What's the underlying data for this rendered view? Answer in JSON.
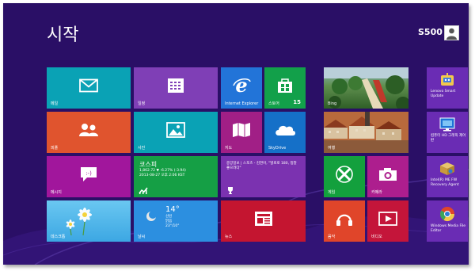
{
  "screen": {
    "title": "시작",
    "user": "S500",
    "colors": {
      "background": "#2a0f66"
    }
  },
  "tiles": {
    "mail": {
      "label": "메일",
      "color": "#0aa2b5",
      "icon": "mail-icon"
    },
    "calendar": {
      "label": "일정",
      "color": "#7f3fb6",
      "icon": "calendar-icon"
    },
    "ie": {
      "label": "Internet Explorer",
      "color": "#2274d8",
      "icon": "internet-explorer-icon"
    },
    "store": {
      "label": "스토어",
      "badge": "15",
      "color": "#12a04a",
      "icon": "store-icon"
    },
    "people": {
      "label": "피플",
      "color": "#e0542e",
      "icon": "people-icon"
    },
    "photos": {
      "label": "사진",
      "color": "#0aa2b5",
      "icon": "photos-icon"
    },
    "maps": {
      "label": "지도",
      "color": "#a11f86",
      "icon": "maps-icon"
    },
    "skydrive": {
      "label": "SkyDrive",
      "color": "#1570c8",
      "icon": "cloud-icon"
    },
    "messaging": {
      "label": "메시지",
      "color": "#a1169c",
      "icon": "messaging-icon"
    },
    "finance": {
      "title": "코스피",
      "line1": "1,862.72  ▼ -6.27% (-3.94)",
      "line2": "2013-08-27 오후 2:06 KST",
      "color": "#159f45",
      "icon": "chart-icon"
    },
    "sports": {
      "text": "중앙일보 | 스포츠 - 김연아, \"발로로 180, 정말 좋으려다\"",
      "color": "#7b32b0",
      "icon": "trophy-icon"
    },
    "desktop": {
      "label": "데스크톱",
      "color": "#4db0e6"
    },
    "weather": {
      "temp": "14°",
      "city": "선린",
      "condition": "맑음",
      "range": "23°/10°",
      "label": "날씨",
      "color": "#2c8fe0",
      "icon": "weather-icon"
    },
    "news": {
      "label": "뉴스",
      "color": "#c41530",
      "icon": "news-icon"
    },
    "bing": {
      "label": "Bing"
    },
    "travel": {
      "label": "여행"
    },
    "games": {
      "label": "게임",
      "color": "#13a03d",
      "icon": "xbox-games-icon"
    },
    "camera": {
      "label": "카메라",
      "color": "#ad1e8e",
      "icon": "camera-icon"
    },
    "music": {
      "label": "음악",
      "color": "#e0452a",
      "icon": "headphones-icon"
    },
    "video": {
      "label": "비디오",
      "color": "#c4153a",
      "icon": "video-icon"
    },
    "lenovo_update": {
      "label": "Lenovo Smart Update",
      "color": "#6a2cb4",
      "icon": "robot-icon"
    },
    "hd_screen": {
      "label": "컴퓨터 HD 그래픽 제어판",
      "color": "#6a2cb4",
      "icon": "monitor-icon"
    },
    "intel_recovery": {
      "label": "Intel(R) ME FW Recovery Agent",
      "color": "#6a2cb4",
      "icon": "box-icon"
    },
    "wmp_editor": {
      "label": "Windows Media File Editor",
      "color": "#6a2cb4",
      "icon": "chrome-icon"
    }
  }
}
